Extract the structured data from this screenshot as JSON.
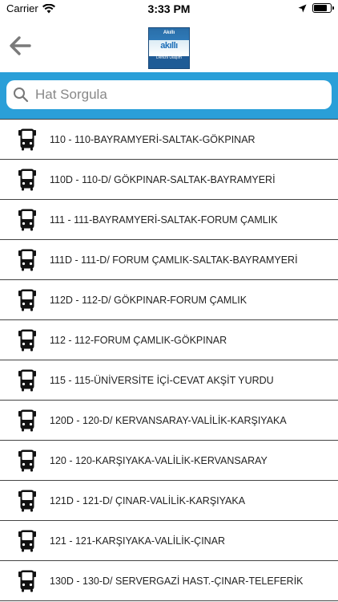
{
  "status_bar": {
    "carrier": "Carrier",
    "time": "3:33 PM",
    "battery_level": 0.9
  },
  "nav": {
    "back_icon": "arrow-left-icon",
    "logo": {
      "top_text": "Akıllı",
      "mid_text": "akıllı",
      "bottom_text": "Denizli Ulaşım"
    }
  },
  "search": {
    "placeholder": "Hat Sorgula",
    "value": "",
    "icon": "search-icon"
  },
  "colors": {
    "accent": "#2a9fd8",
    "divider": "#444444"
  },
  "routes": [
    {
      "label": "110 - 110-BAYRAMYERİ-SALTAK-GÖKPINAR"
    },
    {
      "label": "110D - 110-D/ GÖKPINAR-SALTAK-BAYRAMYERİ"
    },
    {
      "label": "111 - 111-BAYRAMYERİ-SALTAK-FORUM ÇAMLIK"
    },
    {
      "label": "111D - 111-D/ FORUM ÇAMLIK-SALTAK-BAYRAMYERİ"
    },
    {
      "label": "112D - 112-D/ GÖKPINAR-FORUM ÇAMLIK"
    },
    {
      "label": "112 - 112-FORUM ÇAMLIK-GÖKPINAR"
    },
    {
      "label": "115 - 115-ÜNİVERSİTE İÇİ-CEVAT AKŞİT YURDU"
    },
    {
      "label": "120D - 120-D/ KERVANSARAY-VALİLİK-KARŞIYAKA"
    },
    {
      "label": "120 - 120-KARŞIYAKA-VALİLİK-KERVANSARAY"
    },
    {
      "label": "121D - 121-D/ ÇINAR-VALİLİK-KARŞIYAKA"
    },
    {
      "label": "121 - 121-KARŞIYAKA-VALİLİK-ÇINAR"
    },
    {
      "label": "130D - 130-D/ SERVERGAZİ HAST.-ÇINAR-TELEFERİK"
    }
  ]
}
